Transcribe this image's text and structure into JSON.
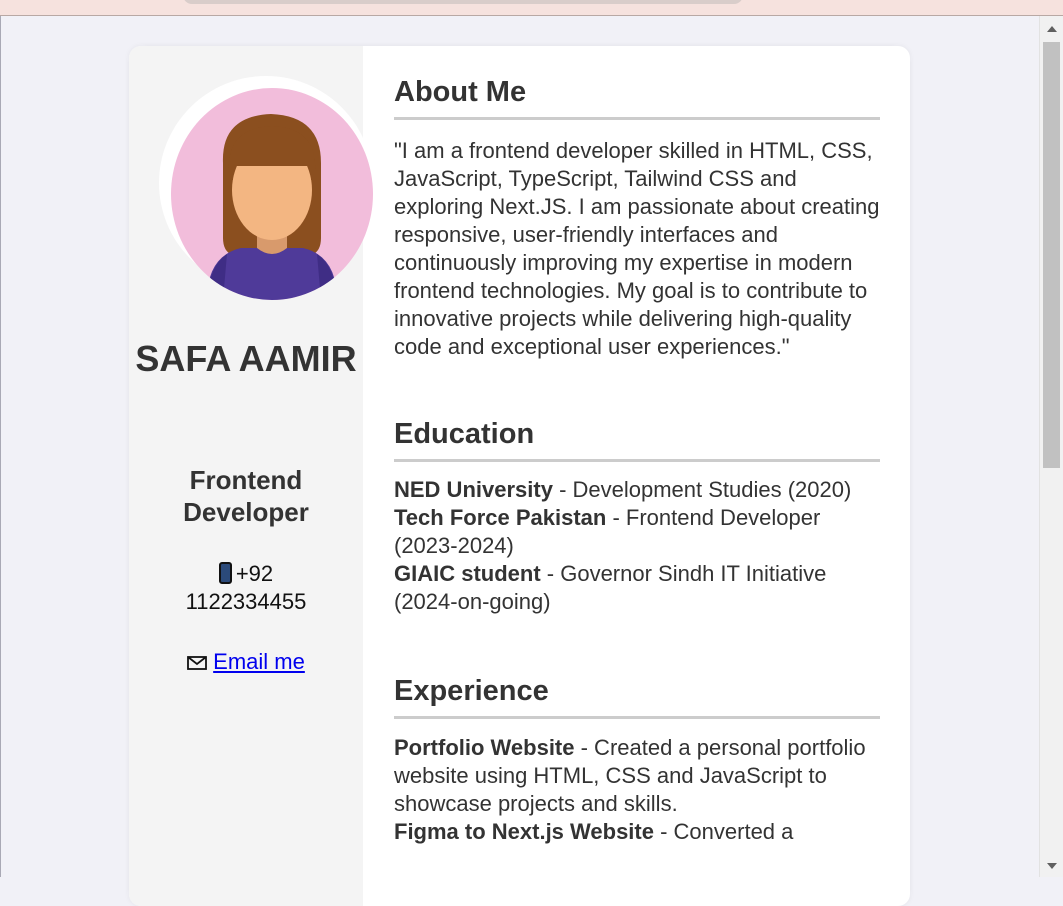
{
  "profile": {
    "name": "SAFA AAMIR",
    "role": "Frontend Developer",
    "phone": "+92 1122334455",
    "email_label": "Email me"
  },
  "about": {
    "heading": "About Me",
    "text": "\"I am a frontend developer skilled in HTML, CSS, JavaScript, TypeScript, Tailwind CSS and exploring Next.JS. I am passionate about creating responsive, user-friendly interfaces and continuously improving my expertise in modern frontend technologies. My goal is to contribute to innovative projects while delivering high-quality code and exceptional user experiences.\""
  },
  "education": {
    "heading": "Education",
    "items": [
      {
        "title": "NED University",
        "detail": " - Development Studies (2020)"
      },
      {
        "title": "Tech Force Pakistan",
        "detail": " - Frontend Developer (2023-2024)"
      },
      {
        "title": "GIAIC student",
        "detail": " - Governor Sindh IT Initiative (2024-on-going)"
      }
    ]
  },
  "experience": {
    "heading": "Experience",
    "items": [
      {
        "title": "Portfolio Website",
        "detail": " - Created a personal portfolio website using HTML, CSS and JavaScript to showcase projects and skills."
      },
      {
        "title": "Figma to Next.js Website",
        "detail": " - Converted a"
      }
    ]
  },
  "icons": {
    "phone": "mobile-phone-icon",
    "email": "envelope-icon"
  },
  "colors": {
    "background": "#f1f1f7",
    "card": "#ffffff",
    "sidebar": "#f4f4f4",
    "avatar_bg": "#f2bddb",
    "link": "#0000ee",
    "divider": "#cccccc"
  }
}
